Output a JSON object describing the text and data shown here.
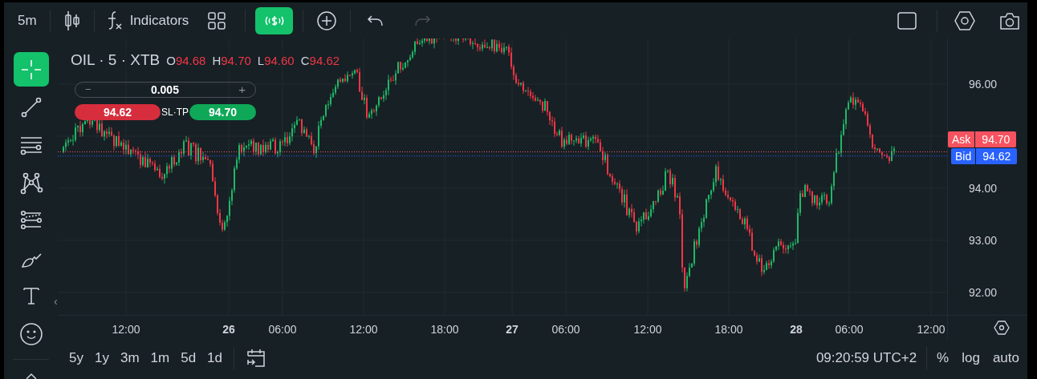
{
  "toolbar": {
    "interval": "5m",
    "indicators_label": "Indicators",
    "trading_active": true,
    "redo_disabled": true
  },
  "tools": [
    {
      "kind": "crosshair",
      "selected": true
    },
    {
      "kind": "trend-line",
      "selected": false
    },
    {
      "kind": "fib",
      "selected": false
    },
    {
      "kind": "pattern",
      "selected": false
    },
    {
      "kind": "projection",
      "selected": false
    },
    {
      "kind": "brush",
      "selected": false
    },
    {
      "kind": "text",
      "selected": false
    },
    {
      "kind": "emoji",
      "selected": false
    }
  ],
  "collapse_arrow": "‹",
  "legend": {
    "symbol": "OIL · 5 · XTB",
    "ohlc": [
      {
        "label": "O",
        "value": "94.68"
      },
      {
        "label": "H",
        "value": "94.70"
      },
      {
        "label": "L",
        "value": "94.60"
      },
      {
        "label": "C",
        "value": "94.62"
      }
    ]
  },
  "order_panel": {
    "minus": "−",
    "quantity": "0.005",
    "plus": "+",
    "sell_price": "94.62",
    "sl_tp_label": "SL·TP",
    "buy_price": "94.70"
  },
  "price_axis": {
    "ticks": [
      "96.00",
      "94.00",
      "93.00",
      "92.00"
    ],
    "ask": {
      "label": "Ask",
      "value": "94.70"
    },
    "bid": {
      "label": "Bid",
      "value": "94.62"
    }
  },
  "time_axis": [
    {
      "label": "12:00",
      "bold": false
    },
    {
      "label": "26",
      "bold": true
    },
    {
      "label": "06:00",
      "bold": false
    },
    {
      "label": "12:00",
      "bold": false
    },
    {
      "label": "18:00",
      "bold": false
    },
    {
      "label": "27",
      "bold": true
    },
    {
      "label": "06:00",
      "bold": false
    },
    {
      "label": "12:00",
      "bold": false
    },
    {
      "label": "18:00",
      "bold": false
    },
    {
      "label": "28",
      "bold": true
    },
    {
      "label": "06:00",
      "bold": false
    },
    {
      "label": "12:00",
      "bold": false
    }
  ],
  "bottom_bar": {
    "ranges": [
      "5y",
      "1y",
      "3m",
      "1m",
      "5d",
      "1d"
    ],
    "clock": "09:20:59 UTC+2",
    "scale_buttons": [
      "%",
      "log",
      "auto"
    ]
  }
}
